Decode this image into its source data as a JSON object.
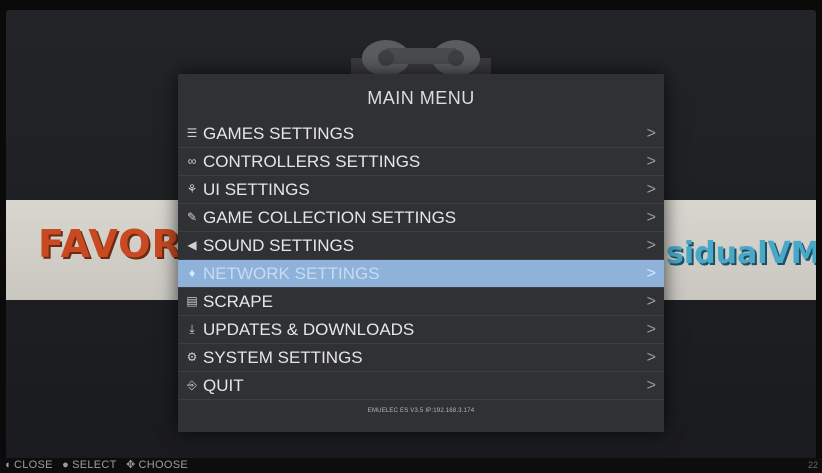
{
  "menu": {
    "title": "MAIN MENU",
    "items": [
      {
        "label": "GAMES SETTINGS",
        "icon": "sliders-icon",
        "glyph": "☰",
        "chevron": ">"
      },
      {
        "label": "CONTROLLERS SETTINGS",
        "icon": "gamepad-icon",
        "glyph": "∞",
        "chevron": ">"
      },
      {
        "label": "UI SETTINGS",
        "icon": "palette-icon",
        "glyph": "⚘",
        "chevron": ">"
      },
      {
        "label": "GAME COLLECTION SETTINGS",
        "icon": "wrench-icon",
        "glyph": "✎",
        "chevron": ">"
      },
      {
        "label": "SOUND SETTINGS",
        "icon": "speaker-icon",
        "glyph": "◀",
        "chevron": ">"
      },
      {
        "label": "NETWORK SETTINGS",
        "icon": "wifi-icon",
        "glyph": "♦",
        "chevron": ">"
      },
      {
        "label": "SCRAPE",
        "icon": "scrape-icon",
        "glyph": "▤",
        "chevron": ">"
      },
      {
        "label": "UPDATES & DOWNLOADS",
        "icon": "download-icon",
        "glyph": "⤓",
        "chevron": ">"
      },
      {
        "label": "SYSTEM SETTINGS",
        "icon": "gears-icon",
        "glyph": "⚙",
        "chevron": ">"
      },
      {
        "label": "QUIT",
        "icon": "exit-icon",
        "glyph": "⎆",
        "chevron": ">"
      }
    ],
    "selected_index": 5,
    "version": "EMUELEC ES V3.5 IP:192.168.3.174"
  },
  "background": {
    "left_logo": "FAVORIT",
    "right_logo": "sidualVM"
  },
  "help": {
    "close": "CLOSE",
    "select": "SELECT",
    "choose": "CHOOSE",
    "close_icon": "b-button-icon",
    "select_icon": "a-button-icon",
    "choose_icon": "dpad-icon"
  },
  "page_indicator": "22",
  "colors": {
    "selection": "#8fb2da",
    "menu_bg": "#2f3134",
    "text": "#e6e6e6"
  }
}
